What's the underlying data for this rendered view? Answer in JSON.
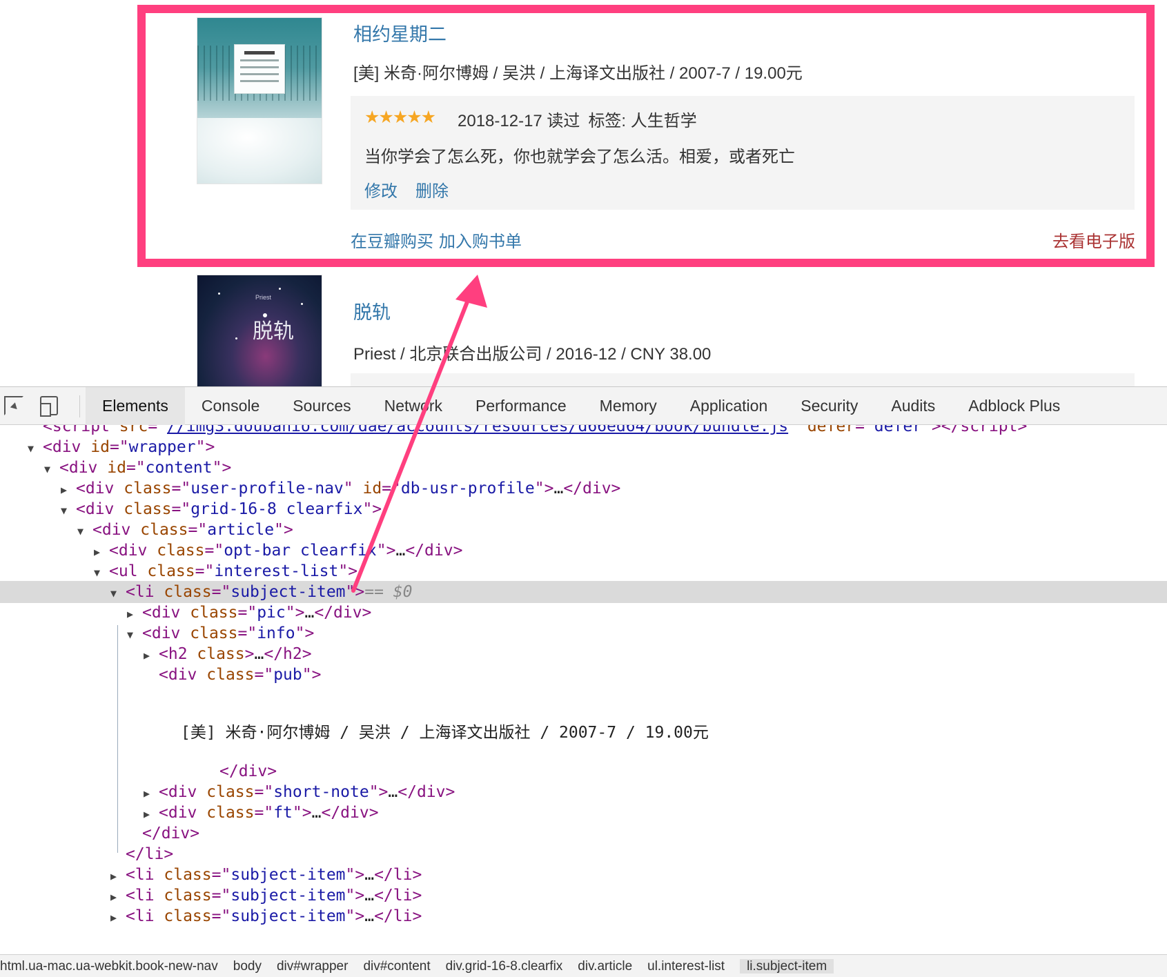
{
  "books": [
    {
      "title": "相约星期二",
      "pub": "[美] 米奇·阿尔博姆 / 吴洪 / 上海译文出版社 / 2007-7 / 19.00元",
      "rating_stars": "★★★★★",
      "date": "2018-12-17 读过",
      "tags": "标签: 人生哲学",
      "comment": "当你学会了怎么死，你也就学会了怎么活。相爱，或者死亡",
      "edit_label": "修改",
      "delete_label": "删除",
      "buy_label": "在豆瓣购买",
      "cart_label": "加入购书单",
      "ebook_label": "去看电子版"
    },
    {
      "title": "脱轨",
      "pub": "Priest / 北京联合出版公司 / 2016-12 / CNY 38.00",
      "cover_text": "脱轨",
      "cover_author": "Priest"
    }
  ],
  "devtools": {
    "tabs": [
      "Elements",
      "Console",
      "Sources",
      "Network",
      "Performance",
      "Memory",
      "Application",
      "Security",
      "Audits",
      "Adblock Plus"
    ],
    "active_tab": "Elements",
    "dom": {
      "script_src": "//img3.doubanio.com/dae/accounts/resources/d66ed64/book/bundle.js",
      "script_defer": "defer",
      "wrapper_id": "wrapper",
      "content_id": "content",
      "nav_class": "user-profile-nav",
      "nav_id": "db-usr-profile",
      "grid_class": "grid-16-8 clearfix",
      "article_class": "article",
      "optbar_class": "opt-bar clearfix",
      "list_class": "interest-list",
      "item_class": "subject-item",
      "selected_marker": "== $0",
      "pic_class": "pic",
      "info_class": "info",
      "pub_class": "pub",
      "pub_text": "[美] 米奇·阿尔博姆 / 吴洪 / 上海译文出版社 / 2007-7 / 19.00元",
      "note_class": "short-note",
      "ft_class": "ft"
    },
    "breadcrumbs": [
      "html.ua-mac.ua-webkit.book-new-nav",
      "body",
      "div#wrapper",
      "div#content",
      "div.grid-16-8.clearfix",
      "div.article",
      "ul.interest-list",
      "li.subject-item"
    ]
  },
  "colors": {
    "link": "#3377aa",
    "highlight": "#ff3f7f",
    "stars": "#f6a623",
    "ebook": "#aa3333"
  }
}
